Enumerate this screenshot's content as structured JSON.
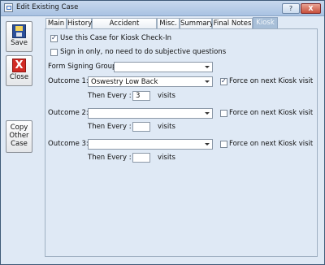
{
  "window": {
    "title": "Edit Existing Case",
    "help_label": "?",
    "close_label": "X"
  },
  "sidebar": {
    "save_label": "Save",
    "close_label": "Close",
    "close_icon_glyph": "X",
    "copy_label_line1": "Copy",
    "copy_label_line2": "Other",
    "copy_label_line3": "Case"
  },
  "tabs": [
    {
      "label": "Main"
    },
    {
      "label": "History"
    },
    {
      "label": "Accident Description"
    },
    {
      "label": "Misc."
    },
    {
      "label": "Summary"
    },
    {
      "label": "Final Notes"
    },
    {
      "label": "Kiosk",
      "active": true
    }
  ],
  "kiosk": {
    "use_case_label": "Use this Case for Kiosk Check-In",
    "use_case_checked": true,
    "sign_in_only_label": "Sign in only, no need to do subjective questions",
    "sign_in_only_checked": false,
    "form_signing_group_label": "Form Signing Group:",
    "form_signing_group_value": "",
    "then_every_label": "Then Every :",
    "visits_label": "visits",
    "force_label": "Force on next Kiosk visit",
    "outcomes": [
      {
        "label": "Outcome 1:",
        "value": "Oswestry Low Back",
        "every": "3",
        "force": true
      },
      {
        "label": "Outcome 2:",
        "value": "",
        "every": "",
        "force": false
      },
      {
        "label": "Outcome 3:",
        "value": "",
        "every": "",
        "force": false
      }
    ]
  },
  "colors": {
    "accent": "#a8bfd8",
    "background": "#dfe9f5"
  },
  "icons": [
    "app-icon",
    "save-icon",
    "close-x-icon",
    "chevron-down-icon",
    "checkmark-icon"
  ]
}
